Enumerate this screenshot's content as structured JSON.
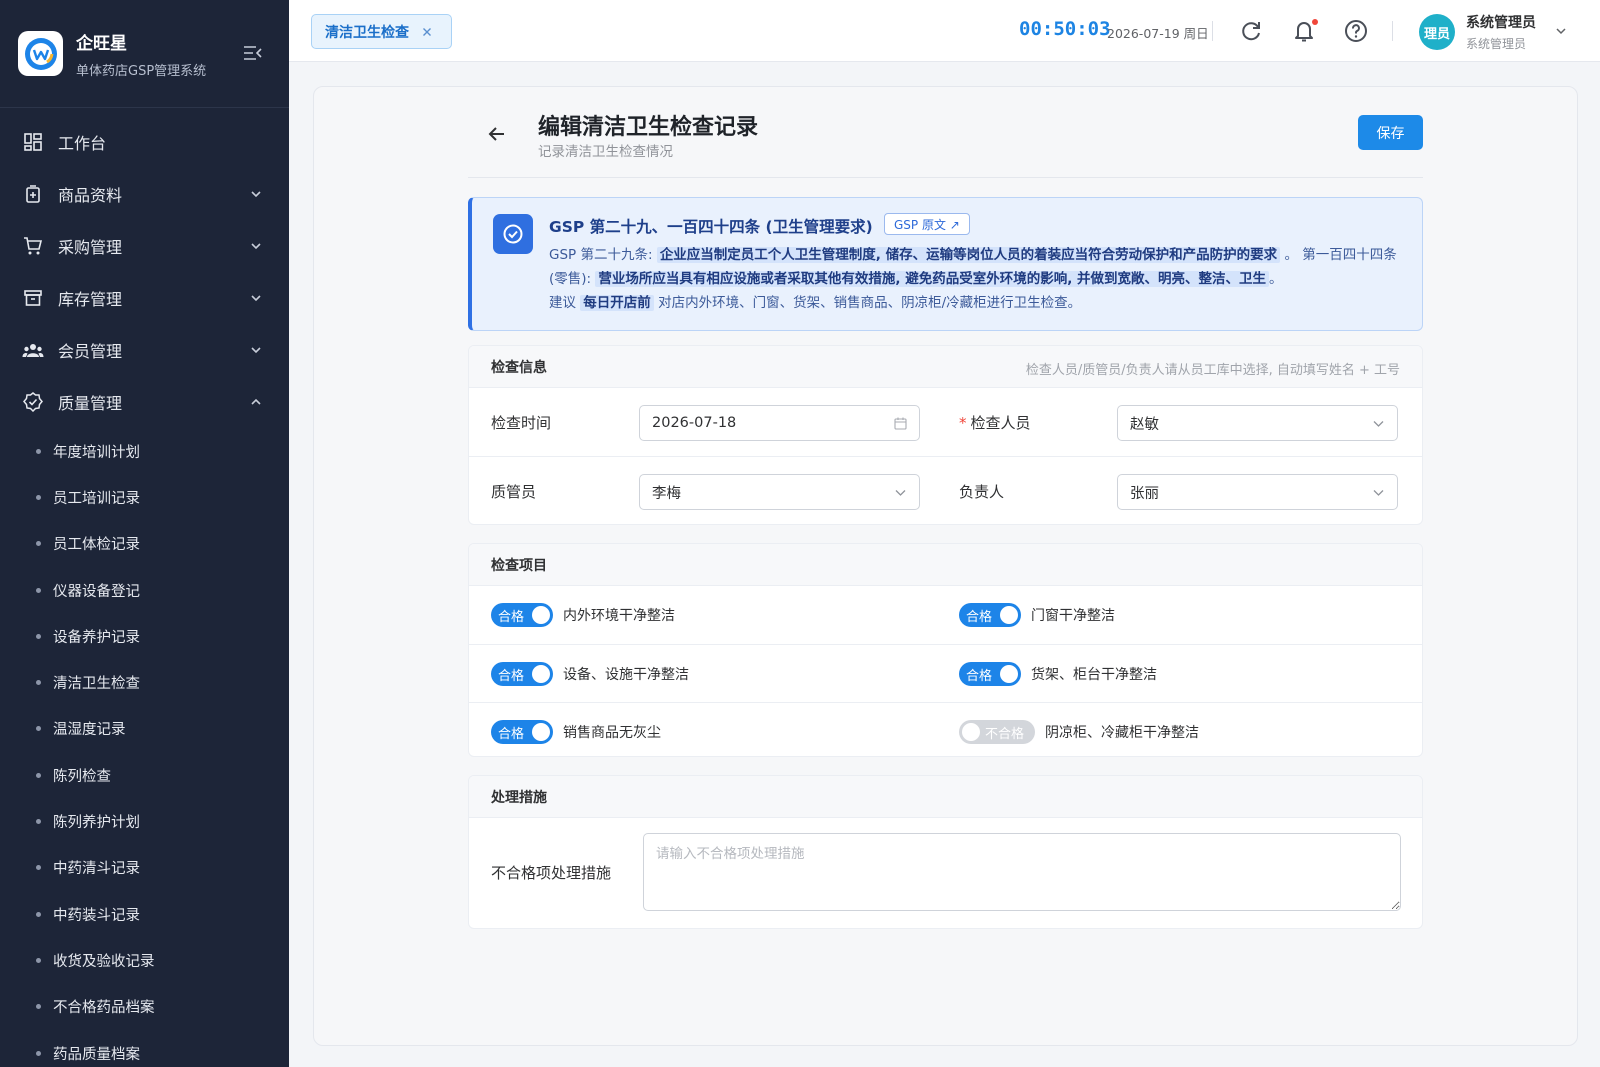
{
  "brand": {
    "name": "企旺星",
    "subtitle": "单体药店GSP管理系统"
  },
  "sidebar": {
    "items": [
      {
        "label": "工作台"
      },
      {
        "label": "商品资料"
      },
      {
        "label": "采购管理"
      },
      {
        "label": "库存管理"
      },
      {
        "label": "会员管理"
      },
      {
        "label": "质量管理"
      }
    ],
    "quality_sub": [
      "年度培训计划",
      "员工培训记录",
      "员工体检记录",
      "仪器设备登记",
      "设备养护记录",
      "清洁卫生检查",
      "温湿度记录",
      "陈列检查",
      "陈列养护计划",
      "中药清斗记录",
      "中药装斗记录",
      "收货及验收记录",
      "不合格药品档案",
      "药品质量档案"
    ]
  },
  "header": {
    "tab_label": "清洁卫生检查",
    "clock": "00:50:03",
    "date": "2026-07-19 周日",
    "avatar_text": "理员",
    "user_name": "系统管理员",
    "user_role": "系统管理员"
  },
  "page": {
    "title": "编辑清洁卫生检查记录",
    "subtitle": "记录清洁卫生检查情况",
    "save_label": "保存"
  },
  "notice": {
    "title": "GSP 第二十九、一百四十四条 (卫生管理要求)",
    "link_label": "GSP 原文 ↗",
    "p1_prefix": "GSP 第二十九条:",
    "p1_highlight": "企业应当制定员工个人卫生管理制度, 储存、运输等岗位人员的着装应当符合劳动保护和产品防护的要求",
    "p1_suffix": "。 第一百四十四条 (零售):",
    "p2_highlight": "营业场所应当具有相应设施或者采取其他有效措施, 避免药品受室外环境的影响, 并做到宽敞、明亮、整洁、卫生",
    "p2_suffix": "。",
    "p3_prefix": "建议",
    "p3_highlight": "每日开店前",
    "p3_suffix": "对店内外环境、门窗、货架、销售商品、阴凉柜/冷藏柜进行卫生检查。"
  },
  "inspection_info": {
    "title": "检查信息",
    "hint": "检查人员/质管员/负责人请从员工库中选择, 自动填写姓名 + 工号",
    "date_label": "检查时间",
    "date_value": "2026-07-18",
    "inspector_label": "检查人员",
    "inspector_value": "赵敏",
    "qa_label": "质管员",
    "qa_value": "李梅",
    "owner_label": "负责人",
    "owner_value": "张丽"
  },
  "check_items": {
    "title": "检查项目",
    "items": [
      {
        "label": "内外环境干净整洁",
        "status": "合格",
        "pass": true
      },
      {
        "label": "门窗干净整洁",
        "status": "合格",
        "pass": true
      },
      {
        "label": "设备、设施干净整洁",
        "status": "合格",
        "pass": true
      },
      {
        "label": "货架、柜台干净整洁",
        "status": "合格",
        "pass": true
      },
      {
        "label": "销售商品无灰尘",
        "status": "合格",
        "pass": true
      },
      {
        "label": "阴凉柜、冷藏柜干净整洁",
        "status": "不合格",
        "pass": false
      }
    ]
  },
  "measures": {
    "title": "处理措施",
    "label": "不合格项处理措施",
    "value": "",
    "placeholder": "请输入不合格项处理措施"
  },
  "colors": {
    "primary": "#1d84e8",
    "sidebar_bg": "#1d2538",
    "notice_bg": "#e9f1fd",
    "required": "#f0463a"
  }
}
